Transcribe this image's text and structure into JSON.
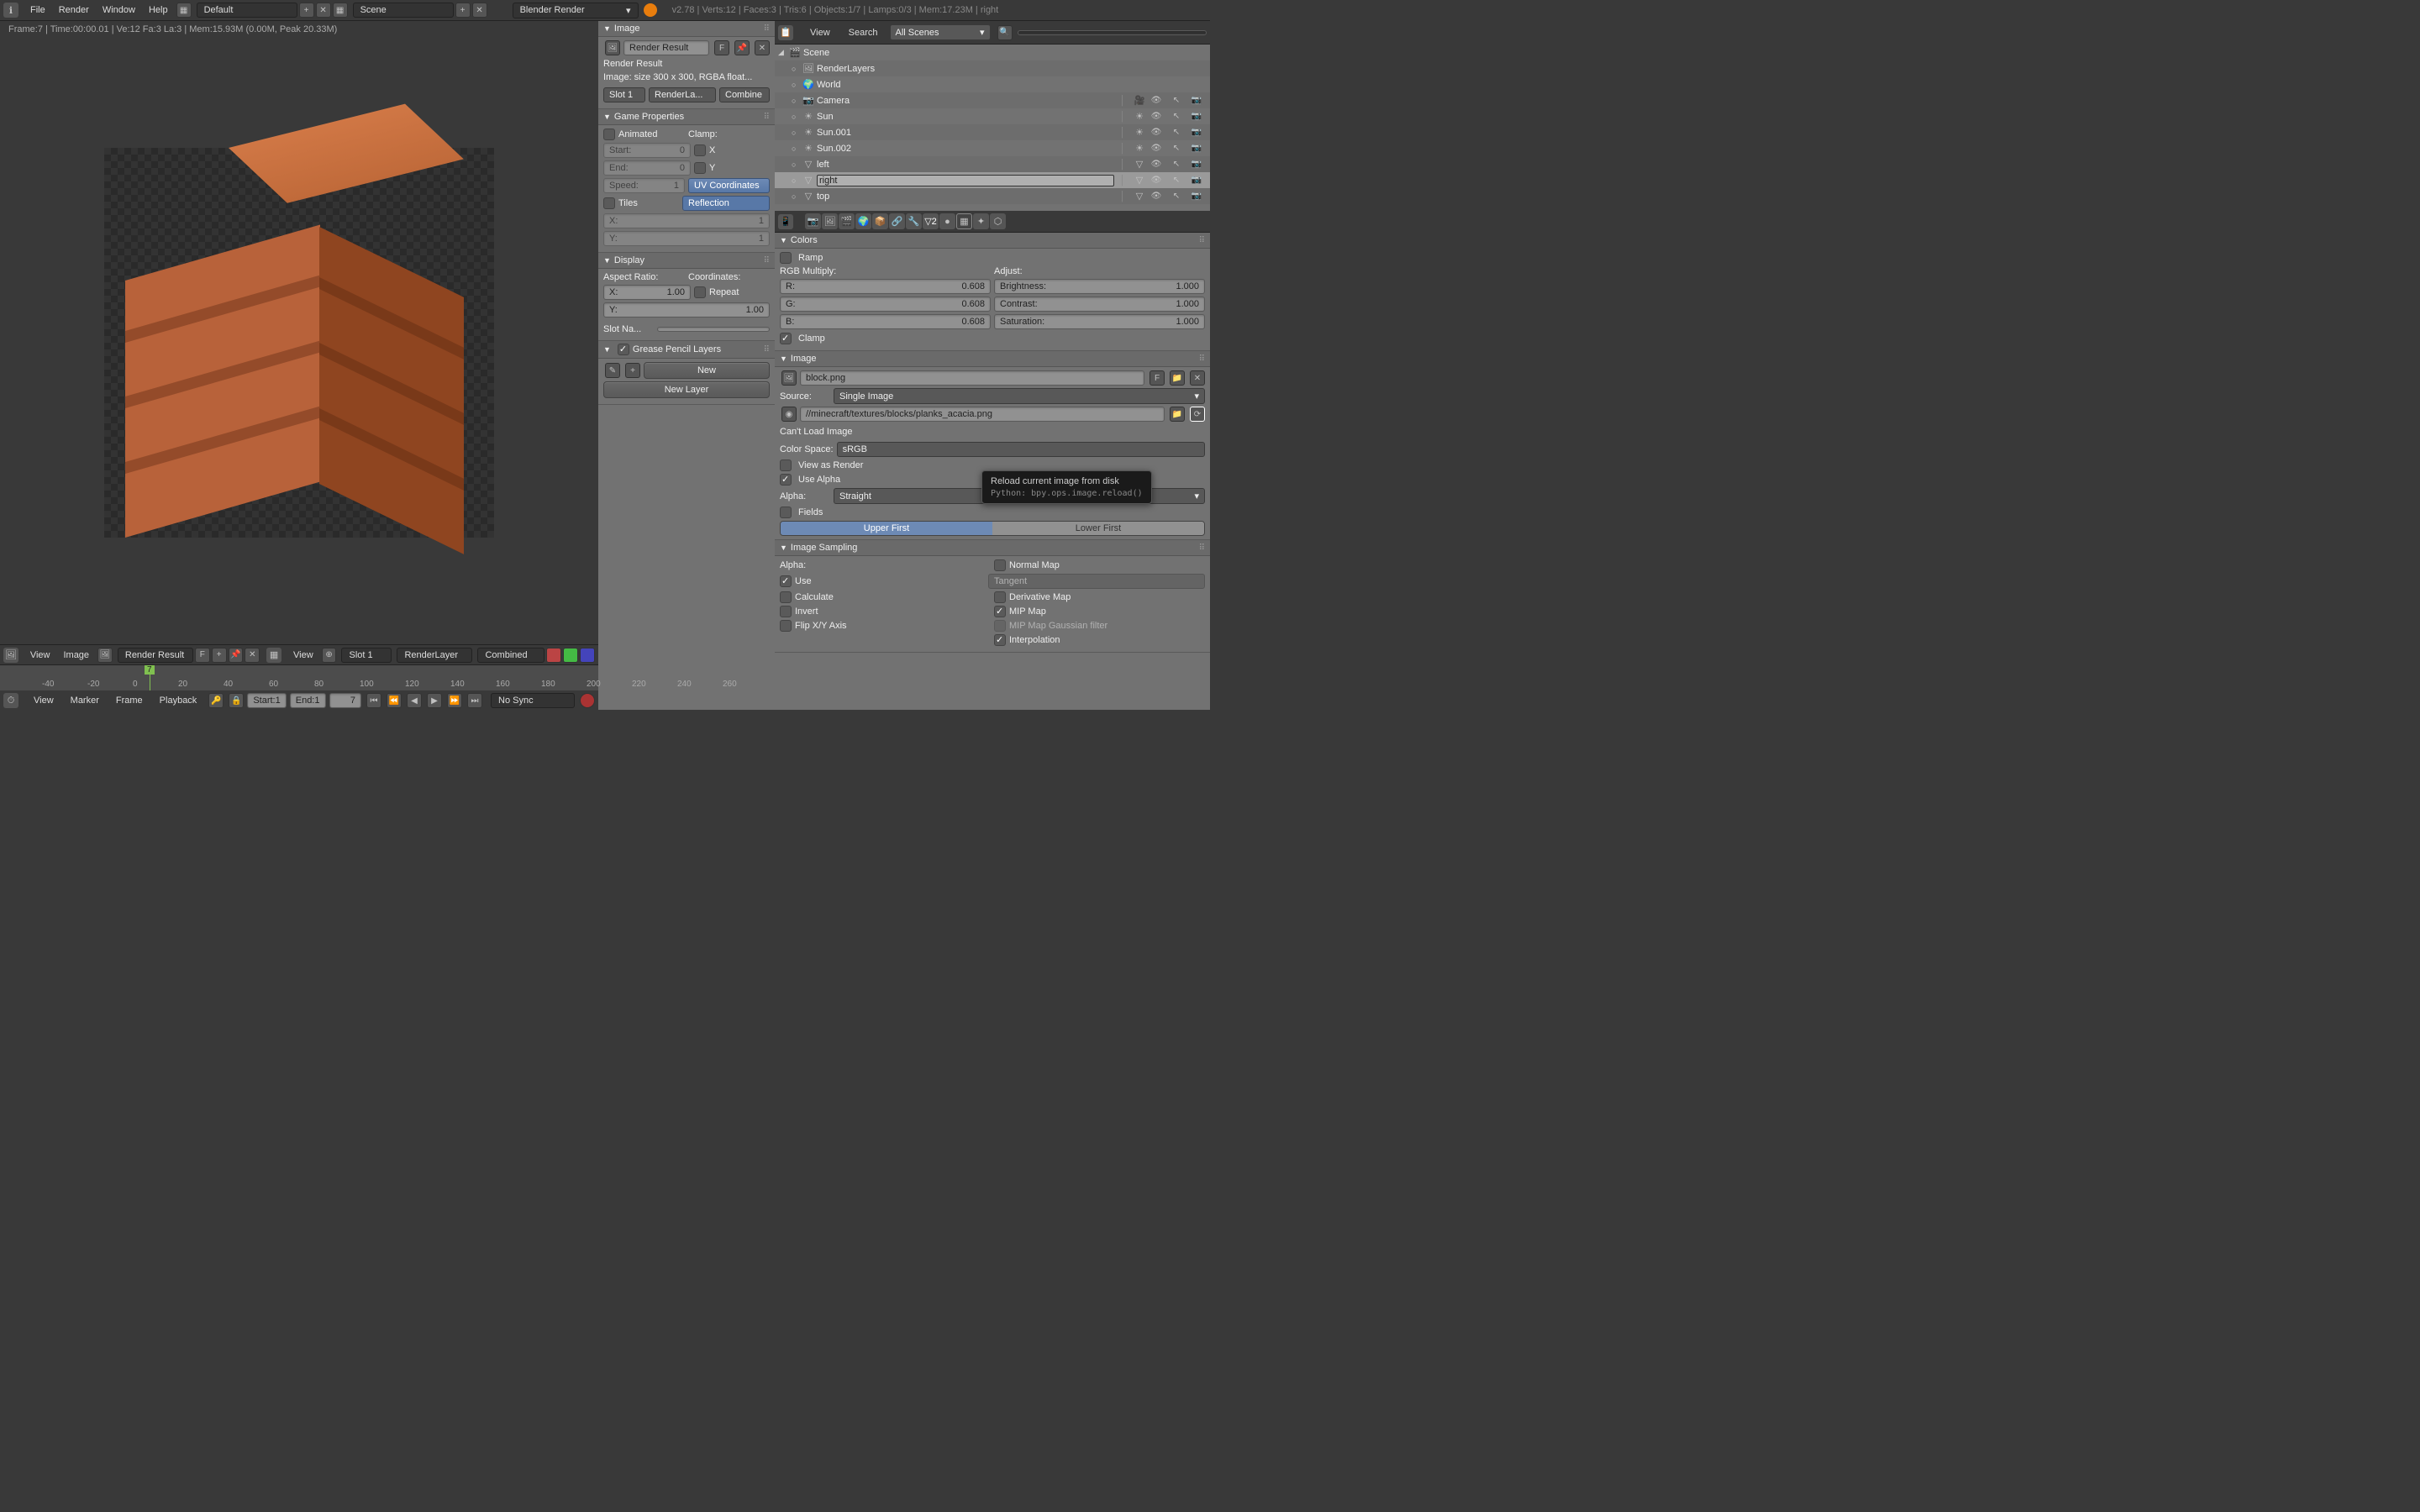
{
  "top": {
    "menus": [
      "File",
      "Render",
      "Window",
      "Help"
    ],
    "layout": "Default",
    "scene": "Scene",
    "engine": "Blender Render",
    "status": "v2.78 | Verts:12 | Faces:3 | Tris:6 | Objects:1/7 | Lamps:0/3 | Mem:17.23M | right"
  },
  "viewport": {
    "header": "Frame:7 | Time:00:00.01 | Ve:12 Fa:3 La:3 | Mem:15.93M (0.00M, Peak 20.33M)",
    "footer_view": "View",
    "footer_image": "Image",
    "footer_render": "Render Result",
    "footer_f": "F",
    "footer_view2": "View",
    "footer_slot": "Slot 1",
    "footer_layer": "RenderLayer",
    "footer_combined": "Combined"
  },
  "img_panel": {
    "image_title": "Image",
    "render_result": "Render Result",
    "result_label": "Render Result",
    "img_info": "Image: size 300 x 300, RGBA float...",
    "slot": "Slot 1",
    "render_la": "RenderLa...",
    "combine": "Combine",
    "game_title": "Game Properties",
    "animated": "Animated",
    "clamp": "Clamp:",
    "start": "Start:",
    "start_v": "0",
    "end": "End:",
    "end_v": "0",
    "speed": "Speed:",
    "speed_v": "1",
    "tiles": "Tiles",
    "x": "X",
    "y": "Y",
    "tiles_x": "X:",
    "tiles_xv": "1",
    "tiles_y": "Y:",
    "tiles_yv": "1",
    "uv_coords": "UV Coordinates",
    "reflection": "Reflection",
    "display_title": "Display",
    "aspect": "Aspect Ratio:",
    "coords": "Coordinates:",
    "repeat": "Repeat",
    "disp_x": "X:",
    "disp_xv": "1.00",
    "disp_y": "Y:",
    "disp_yv": "1.00",
    "slot_na": "Slot Na...",
    "gp_title": "Grease Pencil Layers",
    "new": "New",
    "new_layer": "New Layer"
  },
  "outliner": {
    "view": "View",
    "search": "Search",
    "scope": "All Scenes",
    "items": [
      {
        "name": "Scene",
        "icon": "scene",
        "indent": 0
      },
      {
        "name": "RenderLayers",
        "icon": "renderlayers",
        "indent": 1
      },
      {
        "name": "World",
        "icon": "world",
        "indent": 1
      },
      {
        "name": "Camera",
        "icon": "camera",
        "indent": 1,
        "restrict": true
      },
      {
        "name": "Sun",
        "icon": "lamp",
        "indent": 1,
        "restrict": true
      },
      {
        "name": "Sun.001",
        "icon": "lamp",
        "indent": 1,
        "restrict": true
      },
      {
        "name": "Sun.002",
        "icon": "lamp",
        "indent": 1,
        "restrict": true
      },
      {
        "name": "left",
        "icon": "mesh",
        "indent": 1,
        "restrict": true
      },
      {
        "name": "right",
        "icon": "mesh",
        "indent": 1,
        "restrict": true,
        "sel": true
      },
      {
        "name": "top",
        "icon": "mesh",
        "indent": 1,
        "restrict": true
      }
    ]
  },
  "props": {
    "colors_title": "Colors",
    "ramp": "Ramp",
    "rgb_mult": "RGB Multiply:",
    "adjust": "Adjust:",
    "r": "R:",
    "r_v": "0.608",
    "g": "G:",
    "g_v": "0.608",
    "b": "B:",
    "b_v": "0.608",
    "brightness": "Brightness:",
    "brightness_v": "1.000",
    "contrast": "Contrast:",
    "contrast_v": "1.000",
    "saturation": "Saturation:",
    "saturation_v": "1.000",
    "clamp": "Clamp",
    "image_title": "Image",
    "img_name": "block.png",
    "f": "F",
    "source": "Source:",
    "source_v": "Single Image",
    "path": "//minecraft/textures/blocks/planks_acacia.png",
    "cant_load": "Can't Load Image",
    "colorspace": "Color Space:",
    "colorspace_v": "sRGB",
    "view_as_render": "View as Render",
    "use_alpha": "Use Alpha",
    "alpha": "Alpha:",
    "alpha_v": "Straight",
    "fields": "Fields",
    "upper_first": "Upper First",
    "lower_first": "Lower First",
    "sampling_title": "Image Sampling",
    "alpha2": "Alpha:",
    "use": "Use",
    "calculate": "Calculate",
    "invert": "Invert",
    "flip_xy": "Flip X/Y Axis",
    "normal_map": "Normal Map",
    "tangent": "Tangent",
    "derivative": "Derivative Map",
    "mip_map": "MIP Map",
    "mip_gauss": "MIP Map Gaussian filter",
    "interpolation": "Interpolation"
  },
  "timeline": {
    "view": "View",
    "marker": "Marker",
    "frame": "Frame",
    "playback": "Playback",
    "start": "Start:",
    "start_v": "1",
    "end": "End:",
    "end_v": "1",
    "current": "7",
    "sync": "No Sync",
    "ticks": [
      "-40",
      "-20",
      "0",
      "20",
      "40",
      "60",
      "80",
      "100",
      "120",
      "140",
      "160",
      "180",
      "200",
      "220",
      "240",
      "260"
    ]
  },
  "tooltip": {
    "title": "Reload current image from disk",
    "python": "Python: bpy.ops.image.reload()"
  }
}
